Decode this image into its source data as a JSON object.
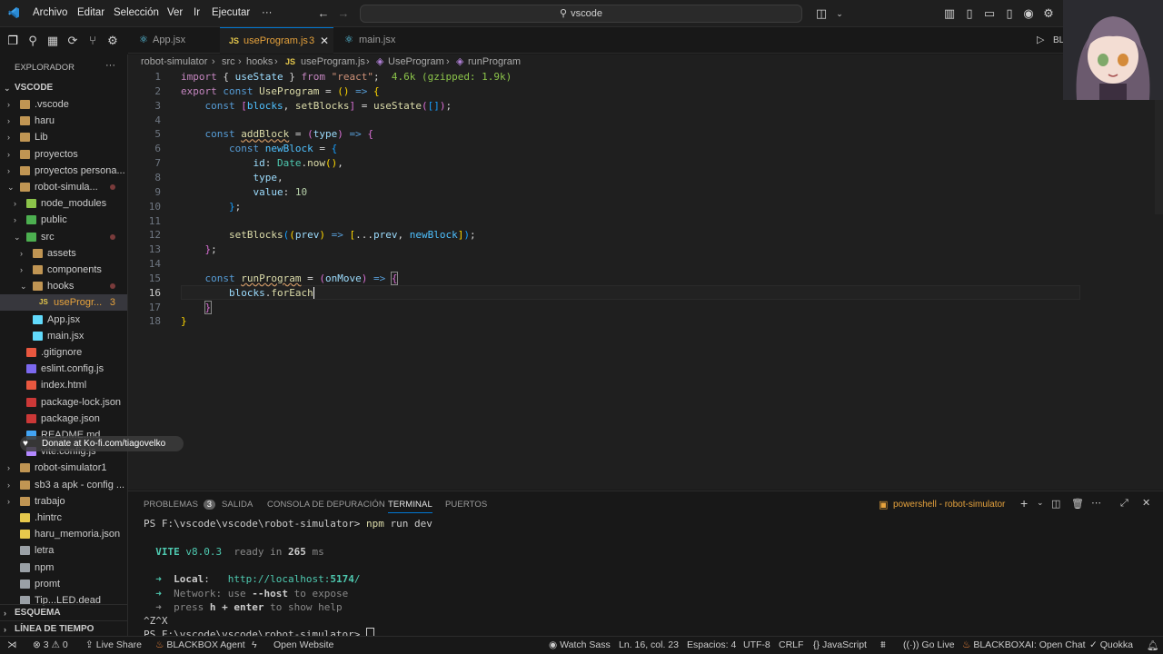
{
  "menu": {
    "items": [
      "Archivo",
      "Editar",
      "Selección",
      "Ver",
      "Ir",
      "Ejecutar"
    ],
    "more": "···"
  },
  "command_center": {
    "text": "vscode"
  },
  "titlebar_right": {
    "run_label": "BL"
  },
  "sidebar": {
    "title": "EXPLORADOR",
    "more": "···",
    "root": "VSCODE",
    "items": [
      {
        "label": ".vscode",
        "depth": 1,
        "type": "folder",
        "state": "collapsed"
      },
      {
        "label": "haru",
        "depth": 1,
        "type": "folder",
        "state": "collapsed"
      },
      {
        "label": "Lib",
        "depth": 1,
        "type": "folder",
        "state": "collapsed"
      },
      {
        "label": "proyectos",
        "depth": 1,
        "type": "folder",
        "state": "collapsed"
      },
      {
        "label": "proyectos persona...",
        "depth": 1,
        "type": "folder",
        "state": "collapsed"
      },
      {
        "label": "robot-simula...",
        "depth": 1,
        "type": "folder",
        "state": "expanded"
      },
      {
        "label": "node_modules",
        "depth": 2,
        "type": "folder-node",
        "state": "collapsed"
      },
      {
        "label": "public",
        "depth": 2,
        "type": "folder-public",
        "state": "collapsed"
      },
      {
        "label": "src",
        "depth": 2,
        "type": "folder-src",
        "state": "expanded"
      },
      {
        "label": "assets",
        "depth": 3,
        "type": "folder",
        "state": "collapsed"
      },
      {
        "label": "components",
        "depth": 3,
        "type": "folder",
        "state": "collapsed"
      },
      {
        "label": "hooks",
        "depth": 3,
        "type": "folder",
        "state": "expanded"
      },
      {
        "label": "useProgr...",
        "depth": 4,
        "type": "js",
        "badge": "3"
      },
      {
        "label": "App.jsx",
        "depth": 3,
        "type": "react"
      },
      {
        "label": "main.jsx",
        "depth": 3,
        "type": "react"
      },
      {
        "label": ".gitignore",
        "depth": 2,
        "type": "git"
      },
      {
        "label": "eslint.config.js",
        "depth": 2,
        "type": "eslint"
      },
      {
        "label": "index.html",
        "depth": 2,
        "type": "html"
      },
      {
        "label": "package-lock.json",
        "depth": 2,
        "type": "npm"
      },
      {
        "label": "package.json",
        "depth": 2,
        "type": "npm"
      },
      {
        "label": "README.md",
        "depth": 2,
        "type": "md"
      },
      {
        "label": "vite.config.js",
        "depth": 2,
        "type": "vite"
      },
      {
        "label": "robot-simulator1",
        "depth": 1,
        "type": "folder",
        "state": "collapsed"
      },
      {
        "label": "sb3 a apk - config ...",
        "depth": 1,
        "type": "folder",
        "state": "collapsed"
      },
      {
        "label": "trabajo",
        "depth": 1,
        "type": "folder",
        "state": "collapsed"
      },
      {
        "label": ".hintrc",
        "depth": 1,
        "type": "json"
      },
      {
        "label": "haru_memoria.json",
        "depth": 1,
        "type": "json"
      },
      {
        "label": "letra",
        "depth": 1,
        "type": "file"
      },
      {
        "label": "npm",
        "depth": 1,
        "type": "file"
      },
      {
        "label": "promt",
        "depth": 1,
        "type": "file"
      },
      {
        "label": "Tip...LED.dead",
        "depth": 1,
        "type": "file"
      }
    ],
    "outline": "ESQUEMA",
    "timeline": "LÍNEA DE TIEMPO"
  },
  "tabs": [
    {
      "label": "App.jsx",
      "icon": "react",
      "active": false
    },
    {
      "label": "useProgram.js",
      "icon": "js",
      "active": true,
      "badge": "3"
    },
    {
      "label": "main.jsx",
      "icon": "react",
      "active": false
    }
  ],
  "breadcrumb": [
    "robot-simulator",
    "src",
    "hooks",
    "useProgram.js",
    "UseProgram",
    "runProgram"
  ],
  "editor": {
    "current_line": 16,
    "lines": [
      {
        "n": "1",
        "html": "<span class='k'>import</span> { <span class='v'>useState</span> } <span class='k'>from</span> <span class='s'>\"react\"</span>;  <span style='color:#8bc34a'>4.6k (gzipped: 1.9k)</span>"
      },
      {
        "n": "2",
        "html": "<span class='k'>export</span> <span class='b'>const</span> <span class='f'>UseProgram</span> = <span class='y'>()</span> <span class='b'>=&gt;</span> <span class='y'>{</span>"
      },
      {
        "n": "3",
        "html": "    <span class='b'>const</span> <span class='p'>[</span><span class='c'>blocks</span>, <span class='f'>setBlocks</span><span class='p'>]</span> = <span class='f'>useState</span><span class='p'>(</span><span style='color:#179fff'>[]</span><span class='p'>)</span>;"
      },
      {
        "n": "4",
        "html": ""
      },
      {
        "n": "5",
        "html": "    <span class='b'>const</span> <span class='f' style='text-decoration:underline wavy #d19a66'>addBlock</span> = <span class='p'>(</span><span class='v'>type</span><span class='p'>)</span> <span class='b'>=&gt;</span> <span class='p'>{</span>"
      },
      {
        "n": "6",
        "html": "        <span class='b'>const</span> <span class='c'>newBlock</span> = <span style='color:#179fff'>{</span>"
      },
      {
        "n": "7",
        "html": "            <span class='v'>id</span>: <span class='t'>Date</span>.<span class='f'>now</span><span class='y'>()</span>,"
      },
      {
        "n": "8",
        "html": "            <span class='v'>type</span>,"
      },
      {
        "n": "9",
        "html": "            <span class='v'>value</span>: <span class='n'>10</span>"
      },
      {
        "n": "10",
        "html": "        <span style='color:#179fff'>}</span>;"
      },
      {
        "n": "11",
        "html": ""
      },
      {
        "n": "12",
        "html": "        <span class='f'>setBlocks</span><span style='color:#179fff'>(</span><span class='y'>(</span><span class='v'>prev</span><span class='y'>)</span> <span class='b'>=&gt;</span> <span class='y'>[</span>...<span class='v'>prev</span>, <span class='c'>newBlock</span><span class='y'>]</span><span style='color:#179fff'>)</span>;"
      },
      {
        "n": "13",
        "html": "    <span class='p'>}</span>;"
      },
      {
        "n": "14",
        "html": ""
      },
      {
        "n": "15",
        "html": "    <span class='b'>const</span> <span class='f' style='text-decoration:underline wavy #d19a66'>runProgram</span> = <span class='p'>(</span><span class='v'>onMove</span><span class='p'>)</span> <span class='b'>=&gt;</span> <span class='p' style='outline:1px solid #888'>{</span>"
      },
      {
        "n": "16",
        "html": "        <span class='v'>blocks</span>.<span class='f'>forEach</span><span style='border-left:1px solid #fff'></span>"
      },
      {
        "n": "17",
        "html": "    <span class='p' style='outline:1px solid #888'>}</span>"
      },
      {
        "n": "18",
        "html": "<span class='y'>}</span>"
      }
    ]
  },
  "panel": {
    "tabs": [
      {
        "label": "PROBLEMAS",
        "badge": "3"
      },
      {
        "label": "SALIDA"
      },
      {
        "label": "CONSOLA DE DEPURACIÓN"
      },
      {
        "label": "TERMINAL",
        "active": true
      },
      {
        "label": "PUERTOS"
      }
    ],
    "terminal_name": "powershell - robot-simulator",
    "terminal": [
      {
        "html": "PS F:\\vscode\\vscode\\robot-simulator&gt; <span style='color:#dcdcaa'>npm</span> run dev"
      },
      {
        "html": ""
      },
      {
        "html": "  <span style='color:#4ec9b0;font-weight:bold'>VITE</span> <span style='color:#4ec9b0'>v8.0.3</span>  <span style='color:#888'>ready in</span> <b>265</b> <span style='color:#888'>ms</span>"
      },
      {
        "html": ""
      },
      {
        "html": "  <span style='color:#4ec9b0'>➜</span>  <b>Local</b>:   <span style='color:#4ec9b0'>http://localhost:<b>5174</b>/</span>"
      },
      {
        "html": "  <span style='color:#4ec9b0'>➜</span>  <span style='color:#888'>Network: use</span> <b>--host</b> <span style='color:#888'>to expose</span>"
      },
      {
        "html": "  <span style='color:#888'>➜  press</span> <b>h + enter</b> <span style='color:#888'>to show help</span>"
      },
      {
        "html": "^Z^X"
      },
      {
        "html": "PS F:\\vscode\\vscode\\robot-simulator&gt; <span style='border:1px solid #ccc'>&nbsp;</span>"
      }
    ]
  },
  "donate": {
    "text": "Donate at Ko-fi.com/tiagovelko"
  },
  "statusbar": {
    "problems_errors": "3",
    "problems_warnings": "0",
    "live_share": "Live Share",
    "blackbox_agent": "BLACKBOX Agent",
    "open_website": "Open Website",
    "watch_sass": "Watch Sass",
    "position": "Ln. 16, col. 23",
    "spaces": "Espacios: 4",
    "encoding": "UTF-8",
    "eol": "CRLF",
    "language": "JavaScript",
    "go_live": "Go Live",
    "blackbox_chat": "BLACKBOXAI: Open Chat",
    "quokka": "Quokka"
  },
  "colors": {
    "accent": "#0078d4",
    "tab_active_text": "#e6a23c",
    "modified_dot": "#7a3b3b"
  }
}
